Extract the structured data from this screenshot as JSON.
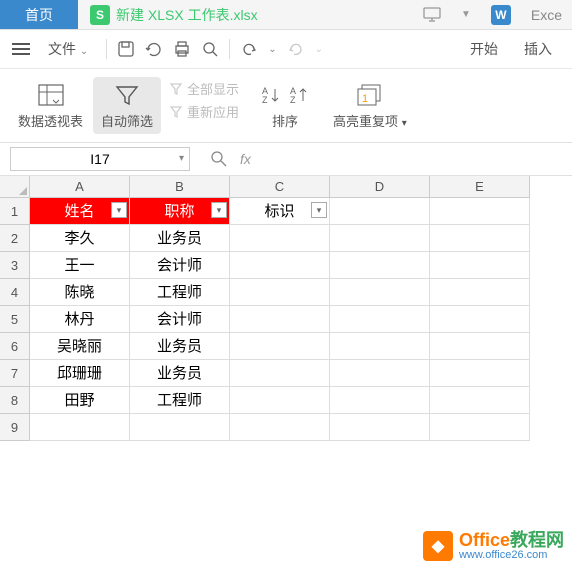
{
  "tabs": {
    "home": "首页",
    "file_icon": "S",
    "file_name": "新建 XLSX 工作表.xlsx",
    "right_icon": "W",
    "right_label": "Exce"
  },
  "menubar": {
    "file": "文件",
    "start": "开始",
    "insert": "插入"
  },
  "toolbar": {
    "pivot": "数据透视表",
    "autofilter": "自动筛选",
    "show_all": "全部显示",
    "reapply": "重新应用",
    "sort": "排序",
    "highlight_dup": "高亮重复项"
  },
  "namebox": {
    "value": "I17"
  },
  "fx": {
    "label": "fx"
  },
  "columns": [
    "A",
    "B",
    "C",
    "D",
    "E"
  ],
  "rows": [
    "1",
    "2",
    "3",
    "4",
    "5",
    "6",
    "7",
    "8",
    "9"
  ],
  "data": {
    "headers": {
      "a": "姓名",
      "b": "职称",
      "c": "标识"
    },
    "rows": [
      {
        "a": "李久",
        "b": "业务员"
      },
      {
        "a": "王一",
        "b": "会计师"
      },
      {
        "a": "陈晓",
        "b": "工程师"
      },
      {
        "a": "林丹",
        "b": "会计师"
      },
      {
        "a": "吴晓丽",
        "b": "业务员"
      },
      {
        "a": "邱珊珊",
        "b": "业务员"
      },
      {
        "a": "田野",
        "b": "工程师"
      }
    ]
  },
  "watermark": {
    "title1": "Office",
    "title2": "教程网",
    "sub": "www.office26.com"
  }
}
